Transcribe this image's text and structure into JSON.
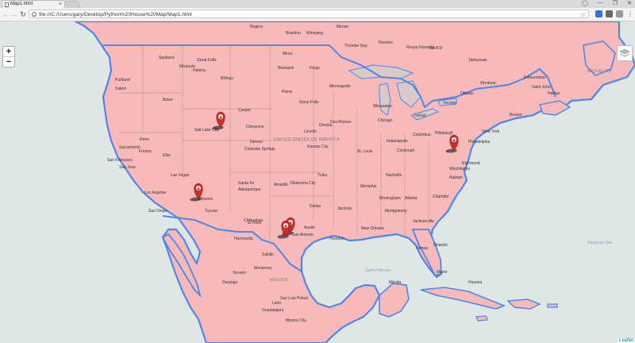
{
  "browser": {
    "tab_title": "Map1.html",
    "tab_close": "×",
    "url": "file:///C:/Users/gary/Desktop/Python%20House%20Map/Map1.html",
    "window_controls": [
      "—",
      "❐",
      "✕"
    ],
    "nav": {
      "back": "←",
      "forward": "→",
      "reload": "↻",
      "info": "i",
      "star": "☆"
    }
  },
  "map": {
    "zoom_in": "+",
    "zoom_out": "−",
    "attribution": "Leaflet",
    "colors": {
      "water": "#dfe6e6",
      "land_overlay": "#f7b9b9",
      "border": "#4f86e8",
      "marker": "#c9302c"
    },
    "marker_icon": "home-icon",
    "markers": [
      "cluster-near-salt-lake",
      "phoenix",
      "washington",
      "texas-cluster"
    ],
    "labels": [
      {
        "t": "Regina"
      },
      {
        "t": "Brandon"
      },
      {
        "t": "Winnipeg"
      },
      {
        "t": "Moose"
      },
      {
        "t": "Thunder Bay"
      },
      {
        "t": "Timmins"
      },
      {
        "t": "Rouyn-Noranda"
      },
      {
        "t": "Val-d'Or"
      },
      {
        "t": "Tadoussac"
      },
      {
        "t": "Edmundston"
      },
      {
        "t": "Saint John"
      },
      {
        "t": "Halifax"
      },
      {
        "t": "MIQUELON"
      },
      {
        "t": "Montreal"
      },
      {
        "t": "Ottawa"
      },
      {
        "t": "Toronto"
      },
      {
        "t": "Detroit"
      },
      {
        "t": "Chicago"
      },
      {
        "t": "Milwaukee"
      },
      {
        "t": "Minneapolis"
      },
      {
        "t": "Fargo"
      },
      {
        "t": "Bismarck"
      },
      {
        "t": "Minot"
      },
      {
        "t": "Spokane"
      },
      {
        "t": "Great Falls"
      },
      {
        "t": "Missoula"
      },
      {
        "t": "Helena"
      },
      {
        "t": "Billings"
      },
      {
        "t": "Portland"
      },
      {
        "t": "Salem"
      },
      {
        "t": "Boise"
      },
      {
        "t": "Casper"
      },
      {
        "t": "Salt Lake City"
      },
      {
        "t": "Cheyenne"
      },
      {
        "t": "Denver"
      },
      {
        "t": "Colorado Springs"
      },
      {
        "t": "Pierre"
      },
      {
        "t": "Sioux Falls"
      },
      {
        "t": "Omaha"
      },
      {
        "t": "Des Moines"
      },
      {
        "t": "Lincoln"
      },
      {
        "t": "Kansas City"
      },
      {
        "t": "St. Louis"
      },
      {
        "t": "Indianapolis"
      },
      {
        "t": "Columbus"
      },
      {
        "t": "Cincinnati"
      },
      {
        "t": "Pittsburgh"
      },
      {
        "t": "Philadelphia"
      },
      {
        "t": "Washington"
      },
      {
        "t": "New York"
      },
      {
        "t": "Boston"
      },
      {
        "t": "Richmond"
      },
      {
        "t": "Raleigh"
      },
      {
        "t": "Charlotte"
      },
      {
        "t": "Nashville"
      },
      {
        "t": "Memphis"
      },
      {
        "t": "Atlanta"
      },
      {
        "t": "Birmingham"
      },
      {
        "t": "Jackson"
      },
      {
        "t": "Montgomery"
      },
      {
        "t": "Jacksonville"
      },
      {
        "t": "Tampa"
      },
      {
        "t": "Orlando"
      },
      {
        "t": "Miami"
      },
      {
        "t": "New Orleans"
      },
      {
        "t": "Houston"
      },
      {
        "t": "San Antonio"
      },
      {
        "t": "Austin"
      },
      {
        "t": "Dallas"
      },
      {
        "t": "Tulsa"
      },
      {
        "t": "Oklahoma City"
      },
      {
        "t": "Amarillo"
      },
      {
        "t": "Albuquerque"
      },
      {
        "t": "Santa Fe"
      },
      {
        "t": "El Paso"
      },
      {
        "t": "Phoenix"
      },
      {
        "t": "Tucson"
      },
      {
        "t": "Las Vegas"
      },
      {
        "t": "Los Angeles"
      },
      {
        "t": "San Diego"
      },
      {
        "t": "Fresno"
      },
      {
        "t": "San Francisco"
      },
      {
        "t": "San Jose"
      },
      {
        "t": "Sacramento"
      },
      {
        "t": "Reno"
      },
      {
        "t": "Elko"
      },
      {
        "t": "Chihuahua"
      },
      {
        "t": "Hermosillo"
      },
      {
        "t": "Monterrey"
      },
      {
        "t": "Saltillo"
      },
      {
        "t": "Torreón"
      },
      {
        "t": "Durango"
      },
      {
        "t": "MÉXICO"
      },
      {
        "t": "San Luis Potosí"
      },
      {
        "t": "León"
      },
      {
        "t": "Guadalajara"
      },
      {
        "t": "Mexico City"
      },
      {
        "t": "Mérida"
      },
      {
        "t": "UNITED STATES OF AMERICA"
      },
      {
        "t": "Gulf of Mexico"
      },
      {
        "t": "Sargasso Sea"
      },
      {
        "t": "Havana"
      }
    ]
  }
}
